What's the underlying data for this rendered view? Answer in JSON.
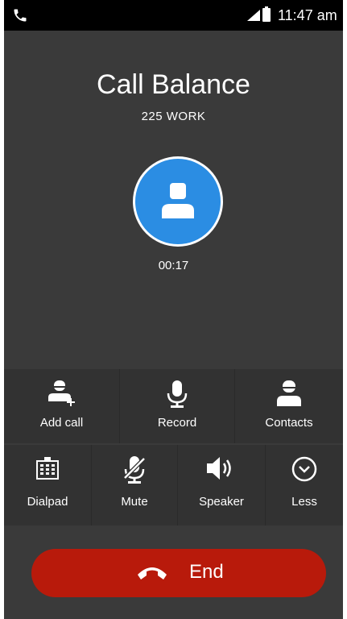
{
  "status_bar": {
    "time": "11:47 am",
    "left_icon": "phone-icon",
    "icons": [
      "signal-icon",
      "battery-icon"
    ]
  },
  "caller": {
    "name": "Call Balance",
    "number_label": "225 WORK",
    "duration": "00:17",
    "avatar_icon": "person-icon",
    "avatar_color": "#2b8de3"
  },
  "controls": {
    "add_call": "Add call",
    "record": "Record",
    "contacts": "Contacts",
    "dialpad": "Dialpad",
    "mute": "Mute",
    "speaker": "Speaker",
    "less": "Less"
  },
  "end_button": {
    "label": "End",
    "color": "#b81a0b"
  }
}
